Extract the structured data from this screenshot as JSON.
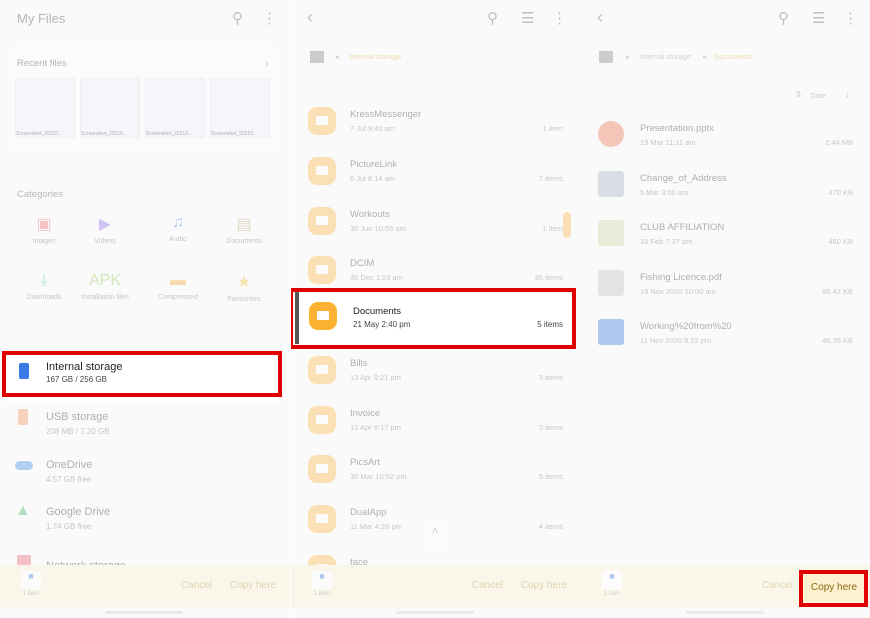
{
  "panel1": {
    "title": "My Files",
    "recent_files": {
      "label": "Recent files",
      "captions": [
        "Screenshot_20210...",
        "Screenshot_20210...",
        "Screenshot_20210...",
        "Screenshot_20210..."
      ]
    },
    "categories": {
      "label": "Categories",
      "items": [
        {
          "label": "Images",
          "icon": "image-icon",
          "color": "#e85a5a"
        },
        {
          "label": "Videos",
          "icon": "video-icon",
          "color": "#8a5ae8"
        },
        {
          "label": "Audio",
          "icon": "audio-icon",
          "color": "#3a6ee8"
        },
        {
          "label": "Documents",
          "icon": "document-icon",
          "color": "#b59a6a"
        },
        {
          "label": "Downloads",
          "icon": "download-icon",
          "color": "#2bb8a8"
        },
        {
          "label": "Installation files",
          "icon": "apk-icon",
          "color": "#8ac23a"
        },
        {
          "label": "Compressed",
          "icon": "compressed-icon",
          "color": "#f0a020"
        },
        {
          "label": "Favourites",
          "icon": "star-icon",
          "color": "#f0c020"
        }
      ]
    },
    "storage": [
      {
        "name": "Internal storage",
        "sub": "167 GB / 256 GB",
        "color": "#3a7be8"
      },
      {
        "name": "USB storage",
        "sub": "208 MB / 7.20 GB",
        "color": "#f4884a"
      },
      {
        "name": "OneDrive",
        "sub": "4.57 GB free",
        "color": "#2a8ae0"
      },
      {
        "name": "Google Drive",
        "sub": "1.74 GB free",
        "color": "#34a853"
      },
      {
        "name": "Network storage",
        "sub": "",
        "color": "#e85a6a"
      }
    ],
    "bottom": {
      "items": "1 item",
      "cancel": "Cancel",
      "copy_here": "Copy here"
    }
  },
  "panel2": {
    "breadcrumb": [
      "Internal storage"
    ],
    "folders": [
      {
        "name": "KressMessenger",
        "date": "7 Jul 9:40 am",
        "count": "1 item"
      },
      {
        "name": "PictureLink",
        "date": "6 Jul 8:14 am",
        "count": "7 items"
      },
      {
        "name": "Workouts",
        "date": "30 Jun 10:55 am",
        "count": "1 item"
      },
      {
        "name": "DCIM",
        "date": "30 Dec 1:23 am",
        "count": "35 items"
      },
      {
        "name": "Documents",
        "date": "21 May 2:40 pm",
        "count": "5 items"
      },
      {
        "name": "Bills",
        "date": "13 Apr 9:21 pm",
        "count": "3 items"
      },
      {
        "name": "Invoice",
        "date": "13 Apr 9:17 pm",
        "count": "3 items"
      },
      {
        "name": "PicsArt",
        "date": "30 Mar 10:52 pm",
        "count": "5 items"
      },
      {
        "name": "DualApp",
        "date": "11 Mar 4:28 pm",
        "count": "4 items"
      },
      {
        "name": "face",
        "date": "",
        "count": ""
      }
    ],
    "bottom": {
      "items": "1 item",
      "cancel": "Cancel",
      "copy_here": "Copy here"
    }
  },
  "panel3": {
    "breadcrumb": [
      "Internal storage",
      "Documents"
    ],
    "sort": "Date",
    "files": [
      {
        "name": "Presentation.pptx",
        "date": "19 Mar 11:11 am",
        "size": "2.44 MB",
        "color": "#e8643a"
      },
      {
        "name": "Change_of_Address",
        "date": "5 Mar 3:00 am",
        "size": "470 KB",
        "color": "#9ab"
      },
      {
        "name": "CLUB AFFILIATION",
        "date": "18 Feb 7:37 pm",
        "size": "460 KB",
        "color": "#cc9"
      },
      {
        "name": "Fishing Licence.pdf",
        "date": "19 Nov 2020 10:00 am",
        "size": "65.42 KB",
        "color": "#bbb"
      },
      {
        "name": "Working%20from%20",
        "date": "11 Nov 2020 9:22 pm",
        "size": "46.35 KB",
        "color": "#2a6ad8"
      }
    ],
    "bottom": {
      "items": "1 item",
      "cancel": "Cancel",
      "copy_here": "Copy here"
    }
  }
}
